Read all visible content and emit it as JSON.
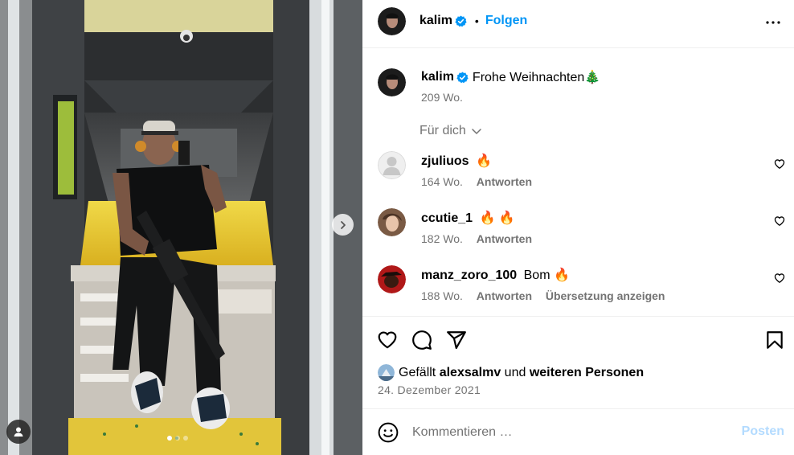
{
  "post": {
    "author": "kalim",
    "verified": true,
    "follow_label": "Folgen",
    "separator": "•",
    "caption": {
      "user": "kalim",
      "text": "Frohe Weihnachten🎄",
      "time": "209 Wo."
    },
    "for_you_label": "Für dich",
    "comments": [
      {
        "user": "zjuliuos",
        "text": "🔥",
        "time": "164 Wo.",
        "reply_label": "Antworten",
        "avatar": "default-avatar"
      },
      {
        "user": "ccutie_1",
        "text": "🔥 🔥",
        "time": "182 Wo.",
        "reply_label": "Antworten",
        "avatar": "photo-avatar"
      },
      {
        "user": "manz_zoro_100",
        "text": "Bom 🔥",
        "time": "188 Wo.",
        "reply_label": "Antworten",
        "translate_label": "Übersetzung anzeigen",
        "avatar": "photo-avatar"
      }
    ],
    "likes": {
      "prefix": "Gefällt",
      "user": "alexsalmv",
      "conj": "und",
      "others": "weiteren Personen"
    },
    "date": "24. Dezember 2021",
    "composer": {
      "placeholder": "Kommentieren …",
      "post_label": "Posten"
    },
    "carousel": {
      "current": 1,
      "total": 3
    }
  },
  "colors": {
    "accent": "#0095f6",
    "muted": "#737373",
    "post_disabled": "#b3dbff",
    "border": "#efefef"
  },
  "icons": [
    "more-options-icon",
    "verified-badge-icon",
    "chevron-down-icon",
    "heart-icon",
    "comment-icon",
    "share-icon",
    "bookmark-icon",
    "emoji-icon",
    "chevron-right-icon",
    "user-tag-icon"
  ]
}
